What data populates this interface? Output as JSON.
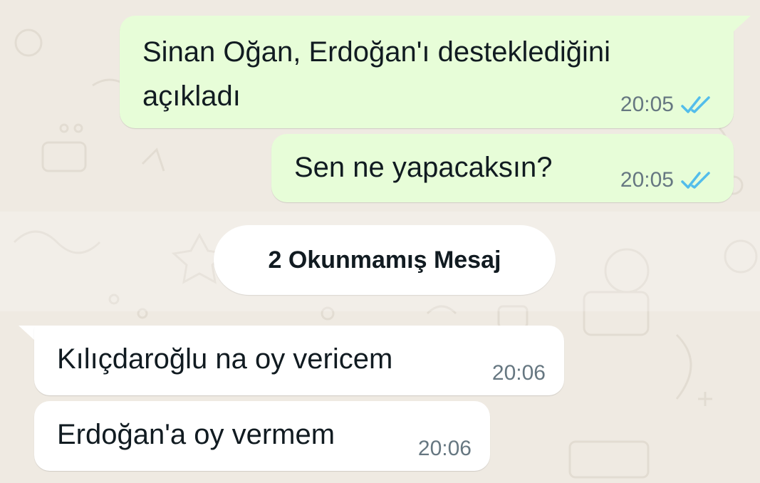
{
  "chat": {
    "unread_divider": "2 Okunmamış Mesaj",
    "messages": [
      {
        "direction": "outgoing",
        "lines": [
          "Sinan Oğan, Erdoğan'ı desteklediğini",
          "açıkladı"
        ],
        "time": "20:05",
        "status": "read",
        "status_icon": "double-check-icon"
      },
      {
        "direction": "outgoing",
        "lines": [
          "Sen ne yapacaksın?"
        ],
        "time": "20:05",
        "status": "read",
        "status_icon": "double-check-icon"
      },
      {
        "direction": "incoming",
        "lines": [
          "Kılıçdaroğlu na oy vericem"
        ],
        "time": "20:06"
      },
      {
        "direction": "incoming",
        "lines": [
          "Erdoğan'a oy vermem"
        ],
        "time": "20:06"
      }
    ]
  },
  "colors": {
    "chat_background": "#efeae2",
    "outgoing_bubble": "#e7fdd8",
    "incoming_bubble": "#ffffff",
    "read_tick": "#53bdeb",
    "time_text": "#667781"
  }
}
